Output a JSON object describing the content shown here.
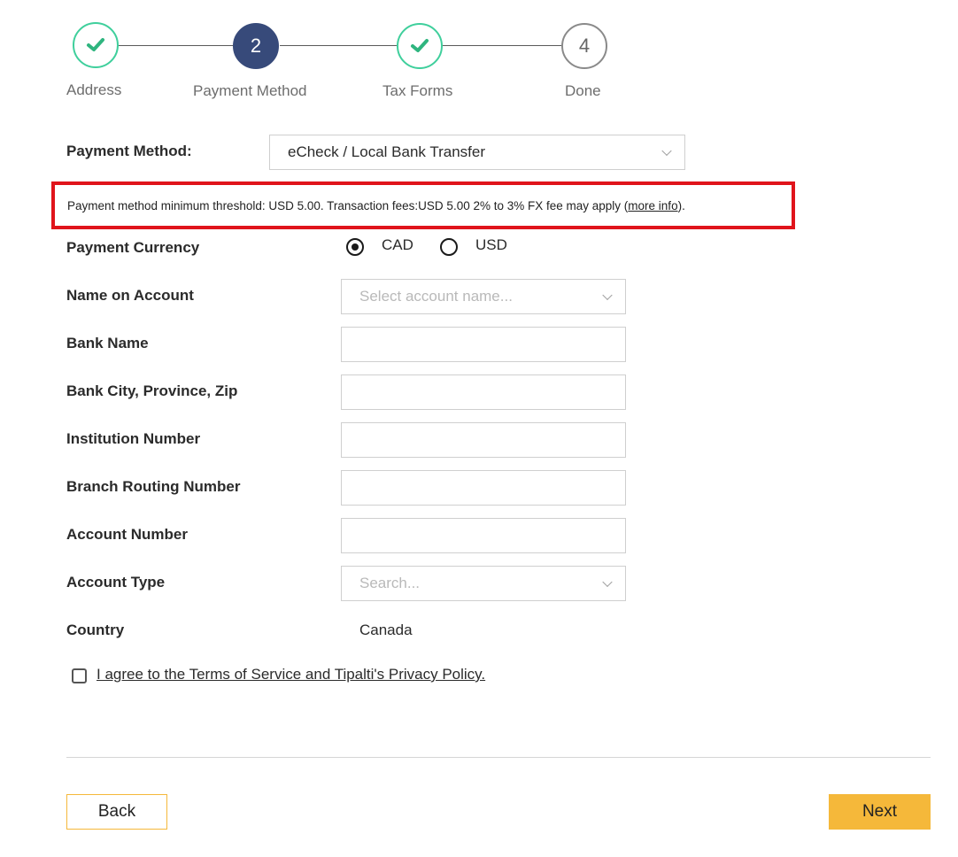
{
  "stepper": {
    "steps": [
      {
        "label": "Address",
        "status": "done",
        "icon": "check-icon"
      },
      {
        "label": "Payment Method",
        "number": "2",
        "status": "active"
      },
      {
        "label": "Tax Forms",
        "status": "done",
        "icon": "check-icon"
      },
      {
        "label": "Done",
        "number": "4",
        "status": "todo"
      }
    ]
  },
  "payment_method": {
    "label": "Payment Method:",
    "selected": "eCheck / Local Bank Transfer"
  },
  "notice": {
    "text": "Payment method minimum threshold: USD 5.00. Transaction fees:USD 5.00 2% to 3% FX fee may apply (",
    "link": "more info",
    "suffix": ")."
  },
  "currency": {
    "label": "Payment Currency",
    "options": [
      {
        "label": "CAD",
        "selected": true
      },
      {
        "label": "USD",
        "selected": false
      }
    ]
  },
  "form": {
    "name_on_account": {
      "label": "Name on Account",
      "placeholder": "Select account name..."
    },
    "bank_name": {
      "label": "Bank Name",
      "value": ""
    },
    "bank_city": {
      "label": "Bank City, Province, Zip",
      "value": ""
    },
    "institution_number": {
      "label": "Institution Number",
      "value": ""
    },
    "branch_routing_number": {
      "label": "Branch Routing Number",
      "value": ""
    },
    "account_number": {
      "label": "Account Number",
      "value": ""
    },
    "account_type": {
      "label": "Account Type",
      "placeholder": "Search..."
    },
    "country": {
      "label": "Country",
      "value": "Canada"
    }
  },
  "agree": {
    "label": "I agree to the Terms of Service and Tipalti's Privacy Policy."
  },
  "buttons": {
    "back": "Back",
    "next": "Next"
  },
  "colors": {
    "done": "#3fcf9c",
    "active": "#374a7a",
    "highlight_border": "#e0141b",
    "accent": "#f5b83a"
  }
}
